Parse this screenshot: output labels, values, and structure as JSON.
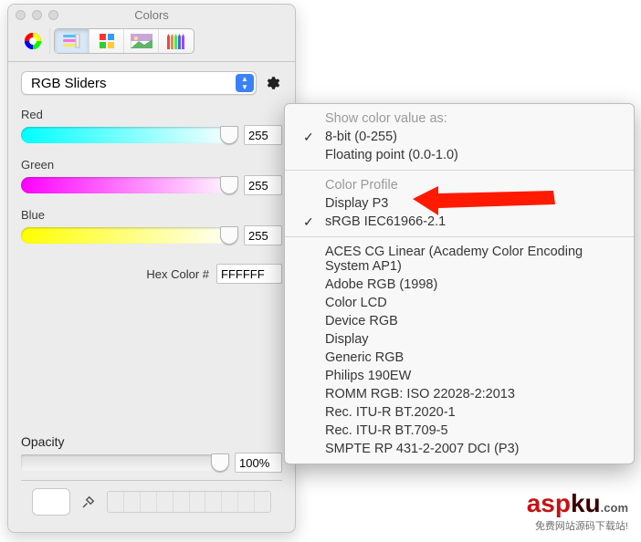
{
  "window": {
    "title": "Colors"
  },
  "mode_select": {
    "value": "RGB Sliders"
  },
  "sliders": {
    "red": {
      "label": "Red",
      "value": "255"
    },
    "green": {
      "label": "Green",
      "value": "255"
    },
    "blue": {
      "label": "Blue",
      "value": "255"
    }
  },
  "hex": {
    "label": "Hex Color #",
    "value": "FFFFFF"
  },
  "opacity": {
    "label": "Opacity",
    "value": "100%"
  },
  "menu": {
    "section1_heading": "Show color value as:",
    "sec1_item1": "8-bit (0-255)",
    "sec1_item2": "Floating point (0.0-1.0)",
    "section2_heading": "Color Profile",
    "sec2_item1": "Display P3",
    "sec2_item2": "sRGB IEC61966-2.1",
    "sec3_item1": "ACES CG Linear (Academy Color Encoding System AP1)",
    "sec3_item2": "Adobe RGB (1998)",
    "sec3_item3": "Color LCD",
    "sec3_item4": "Device RGB",
    "sec3_item5": "Display",
    "sec3_item6": "Generic RGB",
    "sec3_item7": "Philips 190EW",
    "sec3_item8": "ROMM RGB: ISO 22028-2:2013",
    "sec3_item9": "Rec. ITU-R BT.2020-1",
    "sec3_item10": "Rec. ITU-R BT.709-5",
    "sec3_item11": "SMPTE RP 431-2-2007 DCI (P3)"
  },
  "logo": {
    "text1": "asp",
    "text2": "ku",
    "suffix": ".com",
    "sub": "免费网站源码下载站!"
  }
}
